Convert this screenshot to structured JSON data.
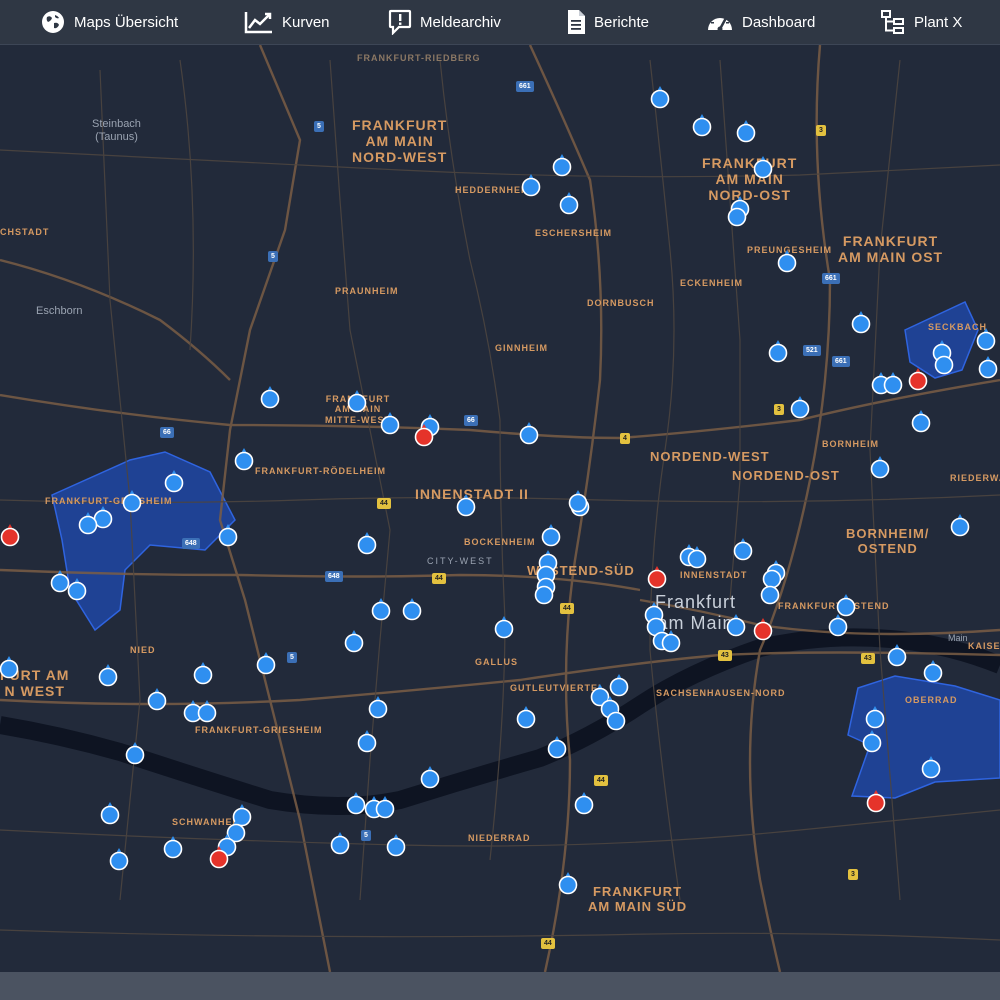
{
  "nav": {
    "items": [
      {
        "label": "Maps Übersicht",
        "icon": "globe-icon"
      },
      {
        "label": "Kurven",
        "icon": "chart-line-icon"
      },
      {
        "label": "Meldearchiv",
        "icon": "alert-message-icon"
      },
      {
        "label": "Berichte",
        "icon": "document-icon"
      },
      {
        "label": "Dashboard",
        "icon": "speedometer-icon"
      },
      {
        "label": "Plant X",
        "icon": "hierarchy-icon"
      }
    ]
  },
  "map": {
    "colors": {
      "background": "#222a3a",
      "roads": "#5a4a3e",
      "river": "#0e1422",
      "zone": "#1f4bb3",
      "pin_ok": "#2f8ff0",
      "pin_alert": "#e5332a"
    },
    "places": {
      "ffm_riedberg": "FRANKFURT-RIEDBERG",
      "nordwest": "FRANKFURT\nAM MAIN\nNORD-WEST",
      "nordost": "FRANKFURT\nAM MAIN\nNORD-OST",
      "main_ost": "FRANKFURT\nAM MAIN OST",
      "heddernheim": "HEDDERNHEIM",
      "eschersheim": "ESCHERSHEIM",
      "preungesheim": "PREUNGESHEIM",
      "eckenheim": "ECKENHEIM",
      "dornbusch": "DORNBUSCH",
      "praunheim": "PRAUNHEIM",
      "ginnheim": "GINNHEIM",
      "seckbach": "SECKBACH",
      "mitte_west": "FRANKFURT\nAM MAIN\nMITTE-WEST",
      "roedelheim": "FRANKFURT-RÖDELHEIM",
      "griesheim_zone": "FRANKFURT-GRIESHEIM",
      "innenstadt2": "INNENSTADT II",
      "nordend_west": "NORDEND-WEST",
      "nordend_ost": "NORDEND-OST",
      "bornheim": "BORNHEIM",
      "riederwald": "RIEDERWALD",
      "bornheim_ostend": "BORNHEIM/\nOSTEND",
      "bockenheim": "BOCKENHEIM",
      "city_west": "CITY-WEST",
      "westend_sued": "WESTEND-SÜD",
      "innenstadt": "INNENSTADT",
      "frankfurt": "Frankfurt\nam Main",
      "ostend": "FRANKFURT-OSTEND",
      "nied": "NIED",
      "main_west": "FURT AM\nN WEST",
      "gallus": "GALLUS",
      "gutleut": "GUTLEUTVIERTEL",
      "sachsenhausen": "SACHSENHAUSEN-NORD",
      "griesheim": "FRANKFURT-GRIESHEIM",
      "kaiserlei": "KAISE",
      "oberrad": "OBERRAD",
      "schwanheim": "SCHWANHEIM",
      "niederrad": "NIEDERRAD",
      "main_sued": "FRANKFURT\nAM MAIN SÜD",
      "steinbach": "Steinbach\n(Taunus)",
      "eschborn": "Eschborn",
      "chstadt": "CHSTADT",
      "main_label": "Main"
    },
    "shields": {
      "a5": "5",
      "a661": "661",
      "a3": "3",
      "a66": "66",
      "a648": "648",
      "a44": "44",
      "a43": "43",
      "a4": "4",
      "a521": "521"
    }
  }
}
